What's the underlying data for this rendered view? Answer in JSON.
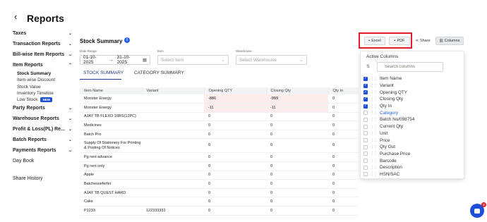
{
  "header": {
    "title": "Reports",
    "back_glyph": "‹"
  },
  "sidebar": {
    "groups": [
      {
        "label": "Taxes"
      },
      {
        "label": "Transaction Reports"
      },
      {
        "label": "Bill-wise Item Reports"
      },
      {
        "label": "Item Reports"
      },
      {
        "label": "Party Reports"
      },
      {
        "label": "Warehouse Reports"
      },
      {
        "label": "Profit & Loss(PL) Re..."
      },
      {
        "label": "Batch Reports"
      },
      {
        "label": "Payments Reports"
      }
    ],
    "item_reports_sub": [
      "Stock Summary",
      "Item-wise Discount",
      "Stock Value",
      "Inventory Timeline",
      "Low Stock"
    ],
    "new_badge": "NEW",
    "day_book": "Day Book",
    "share_history": "Share History"
  },
  "main": {
    "title": "Stock Summary",
    "info_glyph": "i",
    "toolbar": {
      "excel": "Excel",
      "pdf": "PDF",
      "share": "Share",
      "columns": "Columns"
    },
    "filters": {
      "date_range_label": "Date Range",
      "date_from": "01-10-2025",
      "date_to": "31-10-2025",
      "date_sep": "→",
      "item_label": "Item",
      "item_placeholder": "Select Item",
      "warehouse_label": "Warehouse",
      "warehouse_placeholder": "Select Warehouse"
    },
    "tabs": [
      "STOCK SUMMARY",
      "CATEGORY SUMMARY"
    ],
    "table": {
      "columns": [
        "Item Name",
        "Variant",
        "Opening QTY",
        "Closing Qty",
        "Qty In"
      ],
      "rows": [
        [
          "Monster Energy",
          "",
          "-886",
          "-999",
          "0"
        ],
        [
          "Monster Energy",
          "",
          "-11",
          "-11",
          "0"
        ],
        [
          "AJAY TB FLEXO 16RS(12PC)",
          "",
          "0",
          "0",
          "0"
        ],
        [
          "Medicines",
          "",
          "0",
          "0",
          "0"
        ],
        [
          "Batch Pro",
          "",
          "0",
          "0",
          "0"
        ],
        [
          "Supply Of Stationery For Printing & Posting Of Notices",
          "",
          "0",
          "0",
          "0"
        ],
        [
          "Pg rent advance",
          "",
          "0",
          "0",
          "0"
        ],
        [
          "Pg rent only",
          "",
          "0",
          "0",
          "0"
        ],
        [
          "Apple",
          "",
          "0",
          "0",
          "0"
        ],
        [
          "Batchesveferfer",
          "",
          "0",
          "0",
          "0"
        ],
        [
          "AJAY TB QUEST HARD",
          "",
          "0",
          "0",
          "0"
        ],
        [
          "Cake",
          "",
          "0",
          "0",
          "0"
        ],
        [
          "P1233",
          "122333333",
          "0",
          "0",
          "0"
        ]
      ]
    }
  },
  "columns_dropdown": {
    "title": "Active Columns",
    "search_placeholder": "Search columns",
    "items": [
      {
        "label": "Item Name",
        "checked": true
      },
      {
        "label": "Variant",
        "checked": true
      },
      {
        "label": "Opening QTY",
        "checked": true
      },
      {
        "label": "Closing Qty",
        "checked": true
      },
      {
        "label": "Qty In",
        "checked": true
      },
      {
        "label": "Category",
        "checked": false
      },
      {
        "label": "Batch No/098754",
        "checked": false
      },
      {
        "label": "Current Qty",
        "checked": false
      },
      {
        "label": "Unit",
        "checked": false
      },
      {
        "label": "Price",
        "checked": false
      },
      {
        "label": "Qty Out",
        "checked": false
      },
      {
        "label": "Purchase Price",
        "checked": false
      },
      {
        "label": "Barcode",
        "checked": false
      },
      {
        "label": "Description",
        "checked": false
      },
      {
        "label": "HSN/SAC",
        "checked": false
      }
    ]
  },
  "chat": {
    "badge_count": "2"
  },
  "colors": {
    "accent": "#1d4ed8",
    "highlight": "#e11d2a",
    "negative_bg": "#fdecec"
  }
}
